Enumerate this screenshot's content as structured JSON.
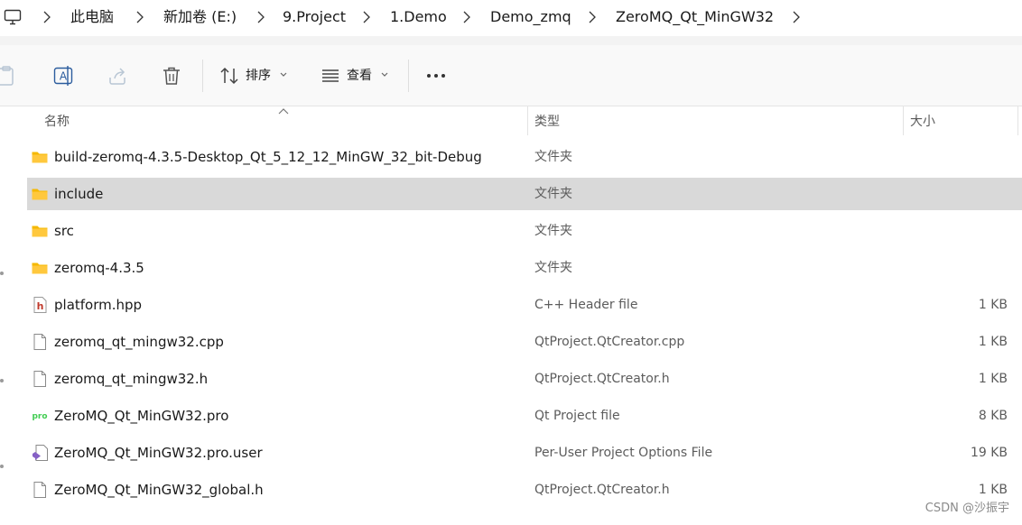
{
  "breadcrumb": {
    "root_icon": "computer-icon",
    "items": [
      "此电脑",
      "新加卷 (E:)",
      "9.Project",
      "1.Demo",
      "Demo_zmq",
      "ZeroMQ_Qt_MinGW32"
    ]
  },
  "toolbar": {
    "sort_label": "排序",
    "view_label": "查看",
    "icons": [
      "paste-icon",
      "rename-icon",
      "share-icon",
      "delete-icon",
      "sort-icon",
      "view-icon",
      "more-icon"
    ]
  },
  "columns": {
    "name": "名称",
    "type": "类型",
    "size": "大小"
  },
  "files": [
    {
      "name": "build-zeromq-4.3.5-Desktop_Qt_5_12_12_MinGW_32_bit-Debug",
      "type": "文件夹",
      "size": "",
      "icon": "folder-icon",
      "selected": false
    },
    {
      "name": "include",
      "type": "文件夹",
      "size": "",
      "icon": "folder-icon",
      "selected": true
    },
    {
      "name": "src",
      "type": "文件夹",
      "size": "",
      "icon": "folder-icon",
      "selected": false
    },
    {
      "name": "zeromq-4.3.5",
      "type": "文件夹",
      "size": "",
      "icon": "folder-icon",
      "selected": false
    },
    {
      "name": "platform.hpp",
      "type": "C++ Header file",
      "size": "1 KB",
      "icon": "cpp-header-icon",
      "selected": false
    },
    {
      "name": "zeromq_qt_mingw32.cpp",
      "type": "QtProject.QtCreator.cpp",
      "size": "1 KB",
      "icon": "file-icon",
      "selected": false
    },
    {
      "name": "zeromq_qt_mingw32.h",
      "type": "QtProject.QtCreator.h",
      "size": "1 KB",
      "icon": "file-icon",
      "selected": false
    },
    {
      "name": "ZeroMQ_Qt_MinGW32.pro",
      "type": "Qt Project file",
      "size": "8 KB",
      "icon": "qt-pro-icon",
      "selected": false
    },
    {
      "name": "ZeroMQ_Qt_MinGW32.pro.user",
      "type": "Per-User Project Options File",
      "size": "19 KB",
      "icon": "visual-studio-file-icon",
      "selected": false
    },
    {
      "name": "ZeroMQ_Qt_MinGW32_global.h",
      "type": "QtProject.QtCreator.h",
      "size": "1 KB",
      "icon": "file-icon",
      "selected": false
    }
  ],
  "watermark": "CSDN @沙振宇",
  "colors": {
    "folder": "#f5b800",
    "selected_row": "#d9d9d9",
    "header_h": "#c0392b",
    "qt_green": "#41cd52",
    "vs_purple": "#8661c5"
  }
}
